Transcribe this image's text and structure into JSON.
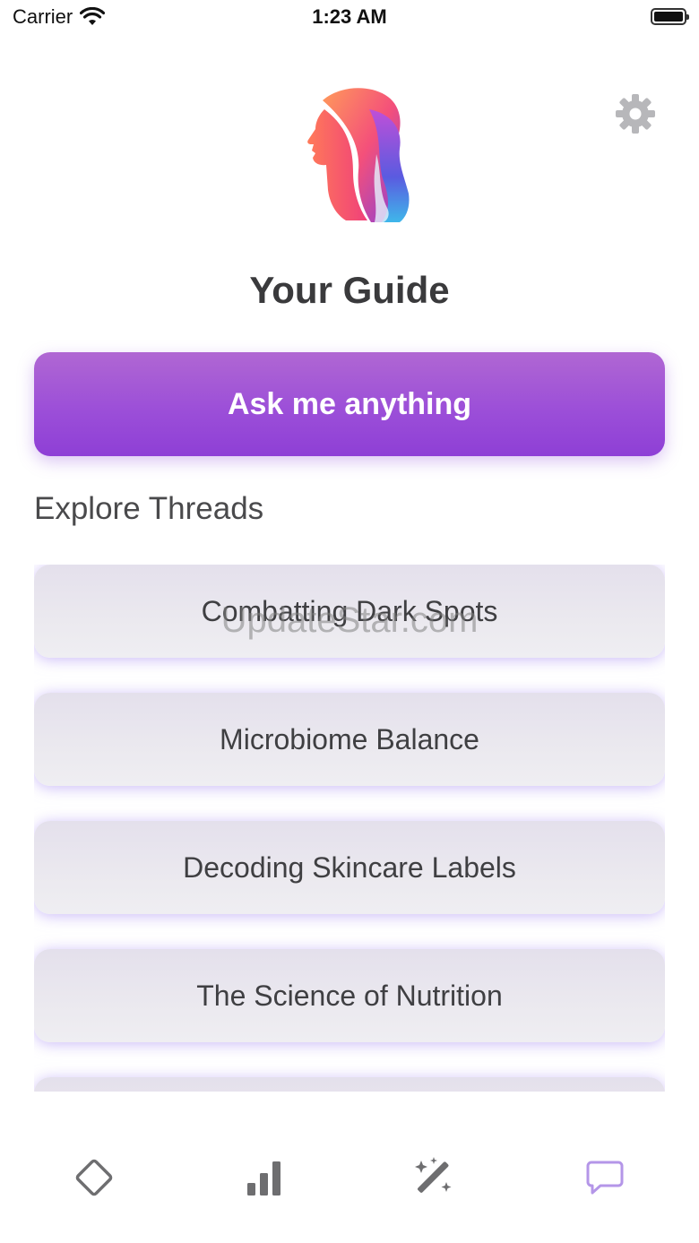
{
  "status_bar": {
    "carrier": "Carrier",
    "time": "1:23 AM"
  },
  "header": {
    "title": "Your Guide",
    "logo_icon": "head-profile-logo-icon",
    "settings_icon": "gear-icon"
  },
  "ask_button": {
    "label": "Ask me anything"
  },
  "threads": {
    "heading": "Explore Threads",
    "items": [
      {
        "label": "Combatting Dark Spots"
      },
      {
        "label": "Microbiome Balance"
      },
      {
        "label": "Decoding Skincare Labels"
      },
      {
        "label": "The Science of Nutrition"
      },
      {
        "label": ""
      }
    ]
  },
  "watermark": "UpdateStar.com",
  "tab_bar": {
    "tabs": [
      {
        "icon": "diamond-icon",
        "active": false
      },
      {
        "icon": "bar-chart-icon",
        "active": false
      },
      {
        "icon": "magic-wand-icon",
        "active": false
      },
      {
        "icon": "chat-bubble-icon",
        "active": true
      }
    ]
  },
  "colors": {
    "accent": "#9c4fd8",
    "active_tab": "#b496e8",
    "inactive_tab": "#6e6e70",
    "card_glow": "#af96f5"
  }
}
